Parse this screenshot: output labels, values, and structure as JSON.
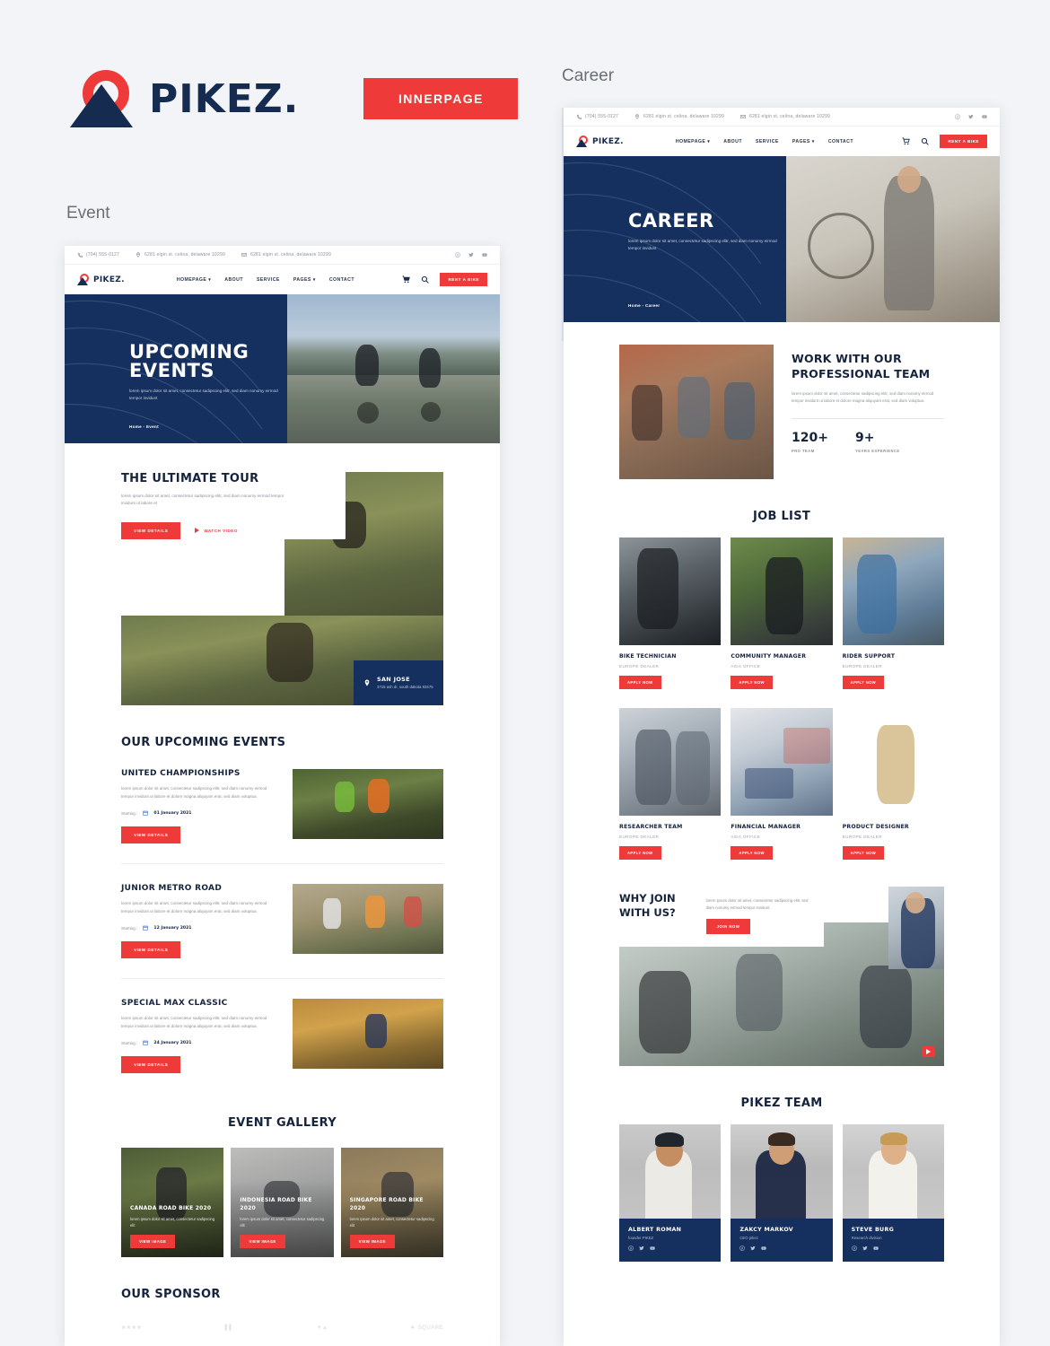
{
  "brand": {
    "name": "PIKEZ.",
    "innerpage_button": "INNERPAGE"
  },
  "colors": {
    "accent": "#ef3a3a",
    "navy": "#15305e",
    "dark": "#15233d",
    "page_bg": "#f2f4f7"
  },
  "previews": [
    {
      "caption": "Event"
    },
    {
      "caption": "Career"
    }
  ],
  "site": {
    "topbar": {
      "phone": "(704) 555-0127",
      "address": "6281 elgin st. celina, delaware 10299",
      "email_address": "6281 elgin st. celina, delaware 10299",
      "social": [
        "facebook-icon",
        "twitter-icon",
        "youtube-icon"
      ]
    },
    "nav": {
      "logo_text": "PIKEZ.",
      "links": [
        "HOMEPAGE",
        "ABOUT",
        "SERVICE",
        "PAGES",
        "CONTACT"
      ],
      "links_with_caret": [
        "HOMEPAGE",
        "PAGES"
      ],
      "cart": "cart-icon",
      "search": "search-icon",
      "cta": "RENT A BIKE"
    }
  },
  "event_page": {
    "hero": {
      "title": "UPCOMING EVENTS",
      "subtitle": "lorem ipsum dolor sit amet, consectetur sadipscing elitr, sed diam nonumy eirmod tempor invidunt",
      "breadcrumb": "Home - Event"
    },
    "tour": {
      "title": "THE ULTIMATE TOUR",
      "desc": "lorem ipsum dolor sit amet, consectetur sadipscing elitr, sed diam nonumy eirmod tempor invidunt ut labore et",
      "primary_button": "VIEW DETAILS",
      "video_link": "WATCH VIDEO",
      "location_name": "SAN JOSE",
      "location_address": "3715 ash dr, south dakota 83475"
    },
    "upcoming": {
      "heading": "OUR UPCOMING EVENTS",
      "date_label": "Starting :",
      "button": "VIEW DETAILS",
      "items": [
        {
          "title": "UNITED CHAMPIONSHIPS",
          "desc": "lorem ipsum dolor sit amet, consectetur sadipscing elitr, sed diam nonumy eirmod tempor invidunt ut labore et dolore magna aliquyam erat, sed diam voluptua.",
          "date": "01 January 2021"
        },
        {
          "title": "JUNIOR METRO ROAD",
          "desc": "lorem ipsum dolor sit amet, consectetur sadipscing elitr, sed diam nonumy eirmod tempor invidunt ut labore et dolore magna aliquyam erat, sed diam voluptua.",
          "date": "12 January 2021"
        },
        {
          "title": "SPECIAL MAX CLASSIC",
          "desc": "lorem ipsum dolor sit amet, consectetur sadipscing elitr, sed diam nonumy eirmod tempor invidunt ut labore et dolore magna aliquyam erat, sed diam voluptua.",
          "date": "24 January 2021"
        }
      ]
    },
    "gallery": {
      "heading": "EVENT GALLERY",
      "button": "VIEW IMAGE",
      "items": [
        {
          "title": "CANADA ROAD BIKE 2020",
          "desc": "lorem ipsum dolor sit amet, consectetur sadipscing elit"
        },
        {
          "title": "INDONESIA ROAD BIKE 2020",
          "desc": "lorem ipsum dolor sit amet, consectetur sadipscing elit"
        },
        {
          "title": "SINGAPORE ROAD BIKE 2020",
          "desc": "lorem ipsum dolor sit amet, consectetur sadipscing elit"
        }
      ]
    },
    "sponsor": {
      "heading": "OUR SPONSOR",
      "logos": [
        "stars-logo",
        "bars-logo",
        "triangle-logo",
        "SQUARE"
      ]
    }
  },
  "career_page": {
    "hero": {
      "title": "CAREER",
      "subtitle": "lorem ipsum dolor sit amet, consectetur sadipscing elitr, sed diam nonumy eirmod tempor invidunt",
      "breadcrumb": "Home - Career"
    },
    "work": {
      "title": "WORK WITH OUR PROFESSIONAL TEAM",
      "desc": "lorem ipsum dolor sit amet, consectetur sadipscing elitr, sed diam nonumy eirmod tempor invidunt ut labore et dolore magna aliquyam erat, sed diam voluptua.",
      "stats": [
        {
          "value": "120+",
          "label": "PRO TEAM"
        },
        {
          "value": "9+",
          "label": "YEARS EXPERIENCE"
        }
      ]
    },
    "jobs": {
      "heading": "JOB LIST",
      "button": "APPLY NOW",
      "items": [
        {
          "title": "BIKE TECHNICIAN",
          "location": "EUROPE DEALER"
        },
        {
          "title": "COMMUNITY MANAGER",
          "location": "ASIA OFFICE"
        },
        {
          "title": "RIDER SUPPORT",
          "location": "EUROPE DEALER"
        },
        {
          "title": "RESEARCHER TEAM",
          "location": "EUROPE DEALER"
        },
        {
          "title": "FINANCIAL MANAGER",
          "location": "ASIA OFFICE"
        },
        {
          "title": "PRODUCT DESIGNER",
          "location": "EUROPE DEALER"
        }
      ]
    },
    "why": {
      "title": "WHY JOIN WITH US?",
      "desc": "lorem ipsum dolor sit amet, consectetur sadipscing elitr, sed diam nonumy eirmod tempor invidunt.",
      "button": "JOIN NOW",
      "play": "play-icon"
    },
    "team": {
      "heading": "PIKEZ TEAM",
      "members": [
        {
          "name": "ALBERT ROMAN",
          "role": "founder PIKEZ"
        },
        {
          "name": "ZAKCY MARKOV",
          "role": "CEO pikez"
        },
        {
          "name": "STEVE BURG",
          "role": "Research division"
        }
      ]
    }
  }
}
